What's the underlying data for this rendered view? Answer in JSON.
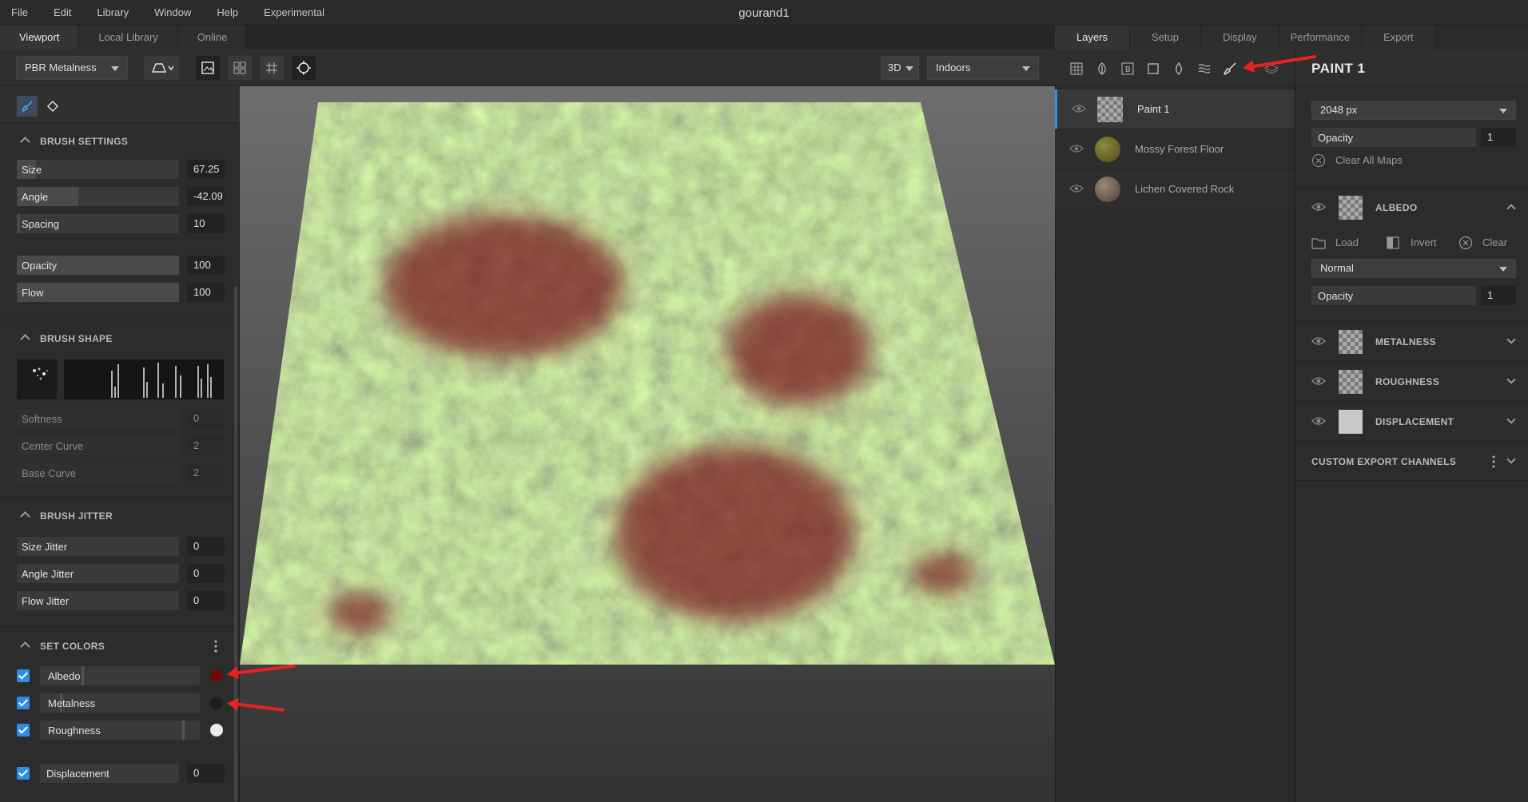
{
  "app": {
    "window_title": "gourand1"
  },
  "menu": [
    "File",
    "Edit",
    "Library",
    "Window",
    "Help",
    "Experimental"
  ],
  "left_tabs": [
    {
      "label": "Viewport",
      "active": true
    },
    {
      "label": "Local Library",
      "active": false
    },
    {
      "label": "Online",
      "active": false
    }
  ],
  "viewport_toolbar": {
    "shader": "PBR Metalness",
    "view_mode": "3D",
    "environment": "Indoors"
  },
  "brush_settings": {
    "title": "BRUSH SETTINGS",
    "sliders": [
      {
        "label": "Size",
        "value": "67.25",
        "fill": 0.12
      },
      {
        "label": "Angle",
        "value": "-42.09",
        "fill": 0.38
      },
      {
        "label": "Spacing",
        "value": "10",
        "fill": 0.02
      },
      {
        "label": "Opacity",
        "value": "100",
        "fill": 1.0
      },
      {
        "label": "Flow",
        "value": "100",
        "fill": 1.0
      }
    ]
  },
  "brush_shape": {
    "title": "BRUSH SHAPE",
    "sliders": [
      {
        "label": "Softness",
        "value": "0"
      },
      {
        "label": "Center Curve",
        "value": "2"
      },
      {
        "label": "Base Curve",
        "value": "2"
      }
    ]
  },
  "brush_jitter": {
    "title": "BRUSH JITTER",
    "sliders": [
      {
        "label": "Size Jitter",
        "value": "0"
      },
      {
        "label": "Angle Jitter",
        "value": "0"
      },
      {
        "label": "Flow Jitter",
        "value": "0"
      }
    ]
  },
  "set_colors": {
    "title": "SET COLORS",
    "rows": [
      {
        "label": "Albedo",
        "swatch": "#6e0a0a",
        "checked": true
      },
      {
        "label": "Metalness",
        "swatch": "#1e1e1e",
        "checked": true
      },
      {
        "label": "Roughness",
        "swatch": "#ececec",
        "checked": true
      }
    ],
    "displacement": {
      "label": "Displacement",
      "value": "0",
      "checked": true
    }
  },
  "right_tabs": [
    {
      "label": "Layers",
      "active": true
    },
    {
      "label": "Setup",
      "active": false
    },
    {
      "label": "Display",
      "active": false
    },
    {
      "label": "Performance",
      "active": false
    },
    {
      "label": "Export",
      "active": false
    }
  ],
  "layer_icons": [
    "grid-icon",
    "leaf-icon",
    "bitmap-icon",
    "square-icon",
    "drop-icon",
    "waves-icon",
    "brush-icon",
    "layers-icon"
  ],
  "layers": [
    {
      "name": "Paint 1",
      "selected": true
    },
    {
      "name": "Mossy Forest Floor",
      "selected": false
    },
    {
      "name": "Lichen Covered Rock",
      "selected": false
    }
  ],
  "properties": {
    "title": "PAINT 1",
    "resolution": "2048 px",
    "opacity_label": "Opacity",
    "opacity_value": "1",
    "clear_all": "Clear All Maps",
    "albedo": {
      "title": "ALBEDO",
      "load": "Load",
      "invert": "Invert",
      "clear": "Clear",
      "blend": "Normal",
      "opacity_label": "Opacity",
      "opacity_value": "1"
    },
    "channels": [
      "METALNESS",
      "ROUGHNESS",
      "DISPLACEMENT"
    ],
    "custom_export": "CUSTOM EXPORT CHANNELS"
  },
  "colors": {
    "accent": "#2f8de4",
    "annotation_arrow": "#e52323"
  }
}
